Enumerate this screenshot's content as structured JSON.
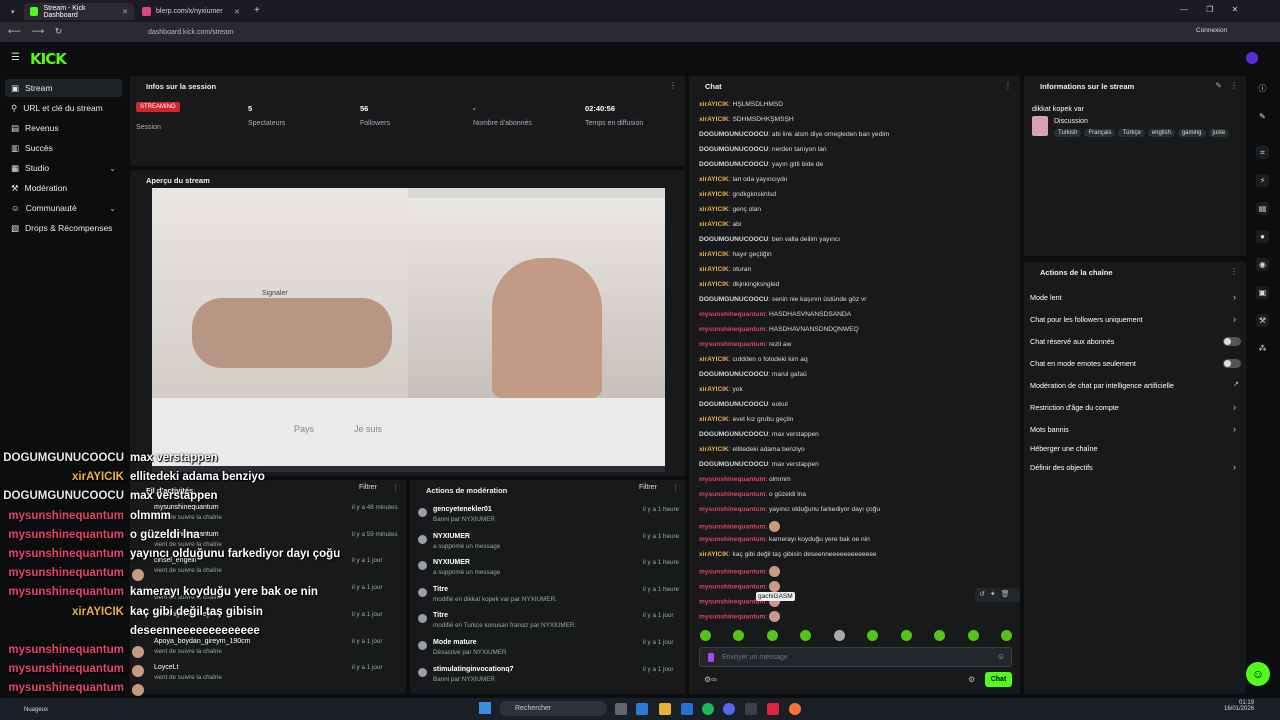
{
  "browser": {
    "tabs": [
      {
        "title": "Stream - Kick Dashboard"
      },
      {
        "title": "blerp.com/x/nyxiumer"
      }
    ],
    "url": "dashboard.kick.com/stream",
    "connexion": "Connexion"
  },
  "nav": {
    "items": [
      "Stream",
      "URL et clé du stream",
      "Revenus",
      "Succès",
      "Studio",
      "Modération",
      "Communauté",
      "Drops & Récompenses"
    ]
  },
  "session": {
    "title": "Infos sur la session",
    "status": "STREAMING",
    "cols": [
      {
        "value": "",
        "label": "Session"
      },
      {
        "value": "5",
        "label": "Spectateurs"
      },
      {
        "value": "56",
        "label": "Followers"
      },
      {
        "value": "-",
        "label": "Nombre d'abonnés"
      },
      {
        "value": "02:40:56",
        "label": "Temps en diffusion"
      }
    ]
  },
  "preview": {
    "title": "Aperçu du stream",
    "pays": "Pays",
    "jesuis": "Je suis",
    "signaler": "Signaler"
  },
  "chat": {
    "title": "Chat",
    "placeholder": "Envoyer un message",
    "send": "Chat",
    "tooltip": "gachiGASM",
    "messages": [
      {
        "u": "xirAYICIK",
        "c": "#e8b040",
        "t": "HŞLMSDLHMSD"
      },
      {
        "u": "xirAYICIK",
        "c": "#e8b040",
        "t": "SDHMSDHKŞMSŞH"
      },
      {
        "u": "DOGUMGUNUCOOCU",
        "c": "#d8d8d8",
        "t": "abi link atsm diye omegleden ban yedim"
      },
      {
        "u": "DOGUMGUNUCOOCU",
        "c": "#d8d8d8",
        "t": "nerden tanıyon lan"
      },
      {
        "u": "DOGUMGUNUCOOCU",
        "c": "#d8d8d8",
        "t": "yayın gitti bide de"
      },
      {
        "u": "xirAYICIK",
        "c": "#e8b040",
        "t": "lan oda yayıncıydıı"
      },
      {
        "u": "xirAYICIK",
        "c": "#e8b040",
        "t": "gndkgknskhlsd"
      },
      {
        "u": "xirAYICIK",
        "c": "#e8b040",
        "t": "genç olan"
      },
      {
        "u": "xirAYICIK",
        "c": "#e8b040",
        "t": "abi"
      },
      {
        "u": "DOGUMGUNUCOOCU",
        "c": "#d8d8d8",
        "t": "ben valla deilim yayıncı"
      },
      {
        "u": "xirAYICIK",
        "c": "#e8b040",
        "t": "hayır geçtiğin"
      },
      {
        "u": "xirAYICIK",
        "c": "#e8b040",
        "t": "oturan"
      },
      {
        "u": "xirAYICIK",
        "c": "#e8b040",
        "t": "dkjnkingksngled"
      },
      {
        "u": "DOGUMGUNUCOOCU",
        "c": "#d8d8d8",
        "t": "senin nie kaşının üstünde göz vr"
      },
      {
        "u": "mysunshinequantum",
        "c": "#e0455f",
        "t": "HASDHASVNANSDSANDA"
      },
      {
        "u": "mysunshinequantum",
        "c": "#e0455f",
        "t": "HASDHAVNANSDNDQNWEQ"
      },
      {
        "u": "mysunshinequantum",
        "c": "#e0455f",
        "t": "rezil aw"
      },
      {
        "u": "xirAYICIK",
        "c": "#e8b040",
        "t": "cıddden o fotodeki kim aq"
      },
      {
        "u": "DOGUMGUNUCOOCU",
        "c": "#d8d8d8",
        "t": "marul gafaü"
      },
      {
        "u": "xirAYICIK",
        "c": "#e8b040",
        "t": "yok"
      },
      {
        "u": "DOGUMGUNUCOOCU",
        "c": "#d8d8d8",
        "t": "eokul"
      },
      {
        "u": "xirAYICIK",
        "c": "#e8b040",
        "t": "evet kız grubu geçtin"
      },
      {
        "u": "DOGUMGUNUCOOCU",
        "c": "#d8d8d8",
        "t": "max verstappen"
      },
      {
        "u": "xirAYICIK",
        "c": "#e8b040",
        "t": "ellitedeki adama benziyo"
      },
      {
        "u": "DOGUMGUNUCOOCU",
        "c": "#d8d8d8",
        "t": "max verstappen"
      },
      {
        "u": "mysunshinequantum",
        "c": "#e0455f",
        "t": "olmmm"
      },
      {
        "u": "mysunshinequantum",
        "c": "#e0455f",
        "t": "o güzeldi lna"
      },
      {
        "u": "mysunshinequantum",
        "c": "#e0455f",
        "t": "yayıncı olduğunu farkediyor dayı çoğu"
      },
      {
        "u": "mysunshinequantum",
        "c": "#e0455f",
        "t": ""
      },
      {
        "u": "mysunshinequantum",
        "c": "#e0455f",
        "t": "kamerayı koyduğu yere bak oe nin"
      },
      {
        "u": "xirAYICIK",
        "c": "#e8b040",
        "t": "kaç gibi değil taş gibisin deseenneeeeeeeeeeeee"
      },
      {
        "u": "mysunshinequantum",
        "c": "#e0455f",
        "t": ""
      },
      {
        "u": "mysunshinequantum",
        "c": "#e0455f",
        "t": ""
      },
      {
        "u": "mysunshinequantum",
        "c": "#e0455f",
        "t": ""
      },
      {
        "u": "mysunshinequantum",
        "c": "#e0455f",
        "t": ""
      }
    ]
  },
  "overlay": [
    {
      "u": "DOGUMGUNUCOOCU",
      "c": "#e8e8e8",
      "t": "max verstappen"
    },
    {
      "u": "xirAYICIK",
      "c": "#f0b429",
      "t": "ellitedeki adama benziyo"
    },
    {
      "u": "DOGUMGUNUCOOCU",
      "c": "#e8e8e8",
      "t": "max verstappen"
    },
    {
      "u": "mysunshinequantum",
      "c": "#e8456a",
      "t": "olmmm"
    },
    {
      "u": "mysunshinequantum",
      "c": "#e8456a",
      "t": "o güzeldi lna"
    },
    {
      "u": "mysunshinequantum",
      "c": "#e8456a",
      "t": "yayıncı olduğunu farkediyor dayı çoğu"
    },
    {
      "u": "mysunshinequantum",
      "c": "#e8456a",
      "t": ""
    },
    {
      "u": "mysunshinequantum",
      "c": "#e8456a",
      "t": "kamerayı koyduğu yere bak oe nin"
    },
    {
      "u": "xirAYICIK",
      "c": "#f0b429",
      "t": "kaç gibi değil taş gibisin"
    },
    {
      "u": "",
      "c": "#f0b429",
      "t": "deseenneeeeeeeeeeeee"
    },
    {
      "u": "mysunshinequantum",
      "c": "#e8456a",
      "t": ""
    },
    {
      "u": "mysunshinequantum",
      "c": "#e8456a",
      "t": ""
    },
    {
      "u": "mysunshinequantum",
      "c": "#e8456a",
      "t": ""
    },
    {
      "u": "mysunshinequantum",
      "c": "#e8456a",
      "t": ""
    }
  ],
  "feed": {
    "title": "Fil d'activités",
    "filter": "Filtrer",
    "items": [
      {
        "name": "mysunshinequantum",
        "sub": "vient de suivre la chaîne",
        "time": "il y a 48 minutes"
      },
      {
        "name": "mysunshinequantum",
        "sub": "vient de suivre la chaîne",
        "time": "il y a 59 minutes"
      },
      {
        "name": "cinsel_engelli",
        "sub": "vient de suivre la chaîne",
        "time": "il y a 1 jour"
      },
      {
        "name": "",
        "sub": "vient de suivre la chaîne",
        "time": "il y a 1 jour"
      },
      {
        "name": "senamiyimsenneyim",
        "sub": "",
        "time": "il y a 1 jour"
      },
      {
        "name": "Apoya_boydan_gireym_190cm",
        "sub": "vient de suivre la chaîne",
        "time": "il y a 1 jour"
      },
      {
        "name": "LoyceLt",
        "sub": "vient de suivre la chaîne",
        "time": "il y a 1 jour"
      }
    ]
  },
  "modactions": {
    "title": "Actions de modération",
    "filter": "Filtrer",
    "items": [
      {
        "name": "gencyetenekler01",
        "sub": "Banni par NYXIUMER",
        "time": "il y a 1 heure"
      },
      {
        "name": "NYXIUMER",
        "sub": "a supprimé un message",
        "time": "il y a 1 heure"
      },
      {
        "name": "NYXIUMER",
        "sub": "a supprimé un message",
        "time": "il y a 1 heure"
      },
      {
        "name": "Titre",
        "sub": "modifié en dikkat kopek var par NYXIUMER.",
        "time": "il y a 1 heure"
      },
      {
        "name": "Titre",
        "sub": "modifié en Turkce konusan fransiz par NYXIUMER.",
        "time": "il y a 1 jour"
      },
      {
        "name": "Mode mature",
        "sub": "Désactivé par NYXIUMER",
        "time": "il y a 1 jour"
      },
      {
        "name": "stimulatinginvocationq7",
        "sub": "Banni par NYXIUMER",
        "time": "il y a 1 jour"
      }
    ]
  },
  "streaminfo": {
    "title": "Informations sur le stream",
    "stream_title": "dikkat kopek var",
    "category": "Discussion",
    "tags": [
      "Turkish",
      "Français",
      "Türkçe",
      "english",
      "gaming",
      "juste"
    ]
  },
  "channelactions": {
    "title": "Actions de la chaîne",
    "items": [
      "Mode lent",
      "Chat pour les followers uniquement",
      "Chat réservé aux abonnés",
      "Chat en mode emotes seulement",
      "Modération de chat par intelligence artificielle",
      "Restriction d'âge du compte",
      "Mots bannis",
      "Héberger une chaîne",
      "Définir des objectifs"
    ]
  },
  "taskbar": {
    "weather": "Nuageux",
    "search": "Rechercher",
    "time": "01:19",
    "date": "16/01/2026"
  }
}
